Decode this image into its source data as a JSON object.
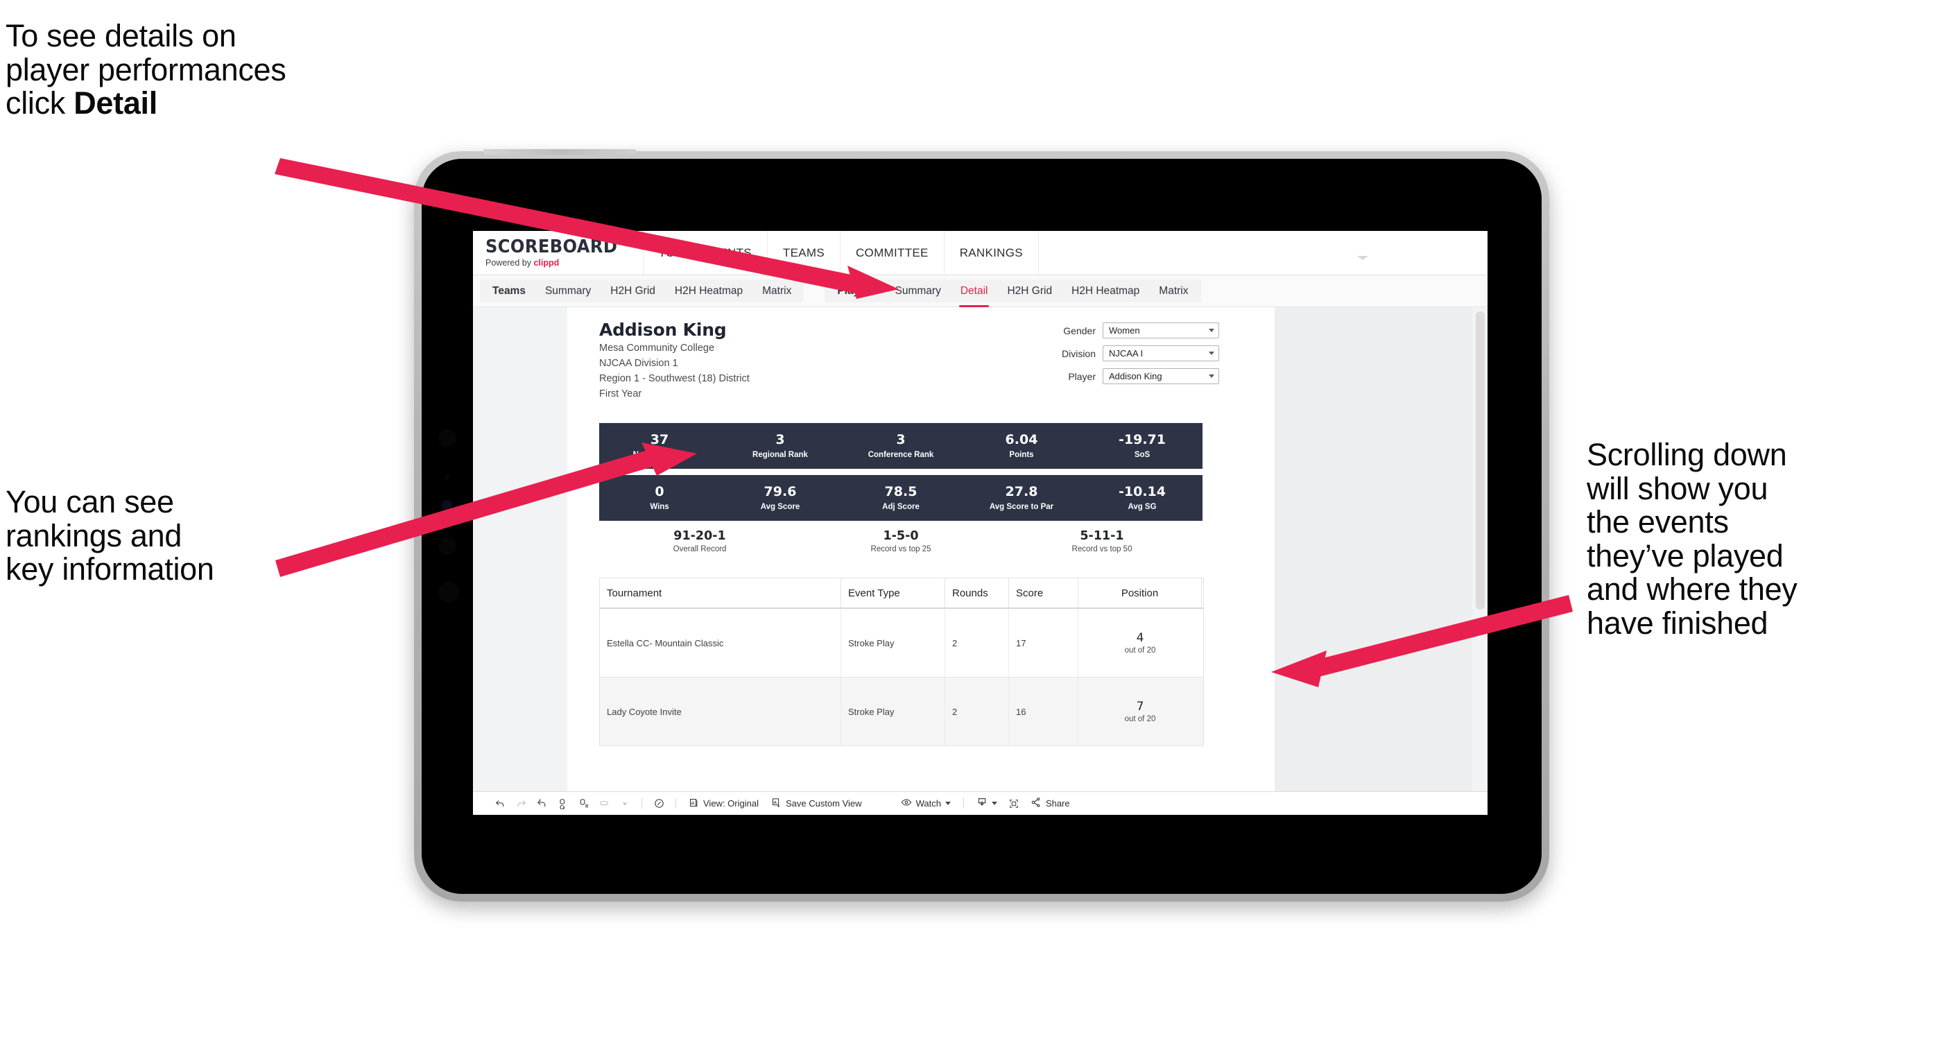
{
  "annotations": {
    "top_left": "To see details on\nplayer performances\nclick ",
    "top_left_bold": "Detail",
    "left": "You can see\nrankings and\nkey information",
    "right": "Scrolling down\nwill show you\nthe events\nthey’ve played\nand where they\nhave finished"
  },
  "app": {
    "brand": {
      "name": "SCOREBOARD",
      "powered_prefix": "Powered by ",
      "powered_brand": "clippd"
    },
    "top_nav": [
      "TOURNAMENTS",
      "TEAMS",
      "COMMITTEE",
      "RANKINGS"
    ],
    "tab_groups": [
      {
        "lead": "Teams",
        "tabs": [
          "Summary",
          "H2H Grid",
          "H2H Heatmap",
          "Matrix"
        ],
        "active": null
      },
      {
        "lead": "Players",
        "tabs": [
          "Summary",
          "Detail",
          "H2H Grid",
          "H2H Heatmap",
          "Matrix"
        ],
        "active": "Detail"
      }
    ]
  },
  "player": {
    "name": "Addison King",
    "school": "Mesa Community College",
    "division": "NJCAA Division 1",
    "region": "Region 1 - Southwest (18) District",
    "year": "First Year"
  },
  "filters": [
    {
      "label": "Gender",
      "value": "Women"
    },
    {
      "label": "Division",
      "value": "NJCAA I"
    },
    {
      "label": "Player",
      "value": "Addison King"
    }
  ],
  "stats_row1": [
    {
      "value": "37",
      "label": "National Rank"
    },
    {
      "value": "3",
      "label": "Regional Rank"
    },
    {
      "value": "3",
      "label": "Conference Rank"
    },
    {
      "value": "6.04",
      "label": "Points"
    },
    {
      "value": "-19.71",
      "label": "SoS"
    }
  ],
  "stats_row2": [
    {
      "value": "0",
      "label": "Wins"
    },
    {
      "value": "79.6",
      "label": "Avg Score"
    },
    {
      "value": "78.5",
      "label": "Adj Score"
    },
    {
      "value": "27.8",
      "label": "Avg Score to Par"
    },
    {
      "value": "-10.14",
      "label": "Avg SG"
    }
  ],
  "records": [
    {
      "value": "91-20-1",
      "label": "Overall Record"
    },
    {
      "value": "1-5-0",
      "label": "Record vs top 25"
    },
    {
      "value": "5-11-1",
      "label": "Record vs top 50"
    }
  ],
  "table": {
    "columns": [
      "Tournament",
      "Event Type",
      "Rounds",
      "Score",
      "Position"
    ],
    "rows": [
      {
        "tournament": "Estella CC- Mountain Classic",
        "event_type": "Stroke Play",
        "rounds": "2",
        "score": "17",
        "position": "4",
        "position_out_of": "out of 20"
      },
      {
        "tournament": "Lady Coyote Invite",
        "event_type": "Stroke Play",
        "rounds": "2",
        "score": "16",
        "position": "7",
        "position_out_of": "out of 20"
      }
    ]
  },
  "toolbar": {
    "view_label": "View: Original",
    "save_label": "Save Custom View",
    "watch_label": "Watch",
    "share_label": "Share"
  },
  "colors": {
    "accent": "#e8204f",
    "stat_bar": "#2e3446",
    "canvas": "#eceef0"
  }
}
